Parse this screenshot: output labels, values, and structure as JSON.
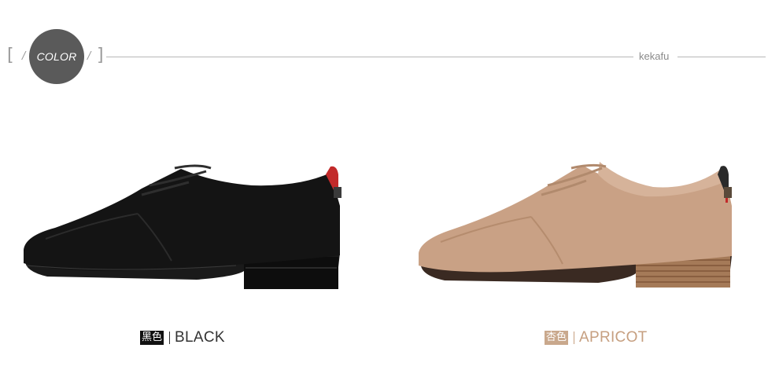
{
  "header": {
    "color_label": "COLOR",
    "brand": "kekafu"
  },
  "products": [
    {
      "cn_label": "黑色",
      "en_label": "BLACK",
      "shoe_color": "#121212",
      "caption_color": "#333333",
      "cn_box_color": "#111111"
    },
    {
      "cn_label": "杏色",
      "en_label": "APRICOT",
      "shoe_color": "#c9a185",
      "caption_color": "#c69f80",
      "cn_box_color": "#c9a88c"
    }
  ]
}
